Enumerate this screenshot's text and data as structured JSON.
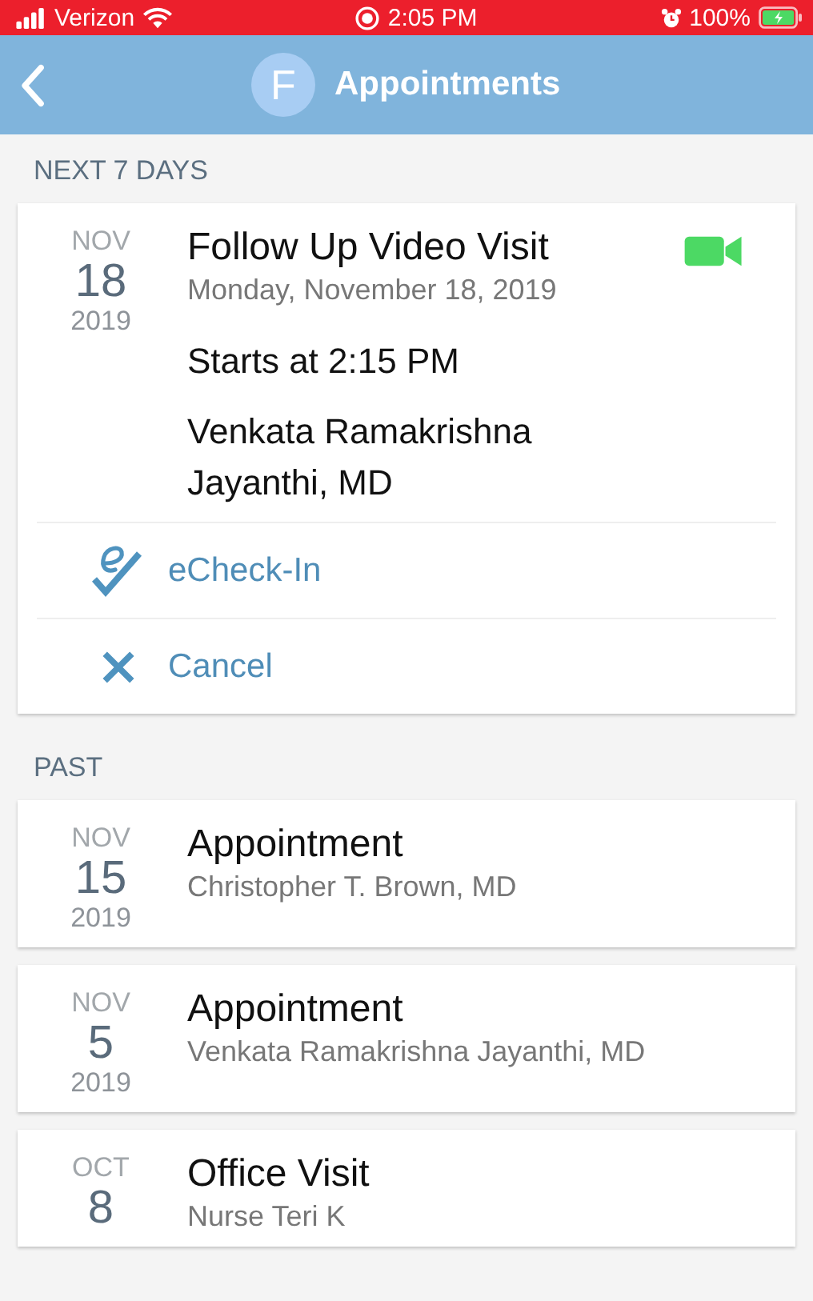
{
  "status_bar": {
    "carrier": "Verizon",
    "time": "2:05 PM",
    "battery": "100%"
  },
  "header": {
    "avatar_letter": "F",
    "title": "Appointments"
  },
  "sections": [
    {
      "heading": "NEXT 7 DAYS",
      "appointments": [
        {
          "month": "NOV",
          "day": "18",
          "year": "2019",
          "title": "Follow Up Video Visit",
          "subtitle": "Monday, November 18, 2019",
          "video": true,
          "details": [
            "Starts at 2:15 PM",
            "Venkata Ramakrishna Jayanthi, MD"
          ],
          "actions": [
            {
              "kind": "echeckin",
              "label": "eCheck-In"
            },
            {
              "kind": "cancel",
              "label": "Cancel"
            }
          ]
        }
      ]
    },
    {
      "heading": "PAST",
      "appointments": [
        {
          "month": "NOV",
          "day": "15",
          "year": "2019",
          "title": "Appointment",
          "subtitle": "Christopher T. Brown, MD"
        },
        {
          "month": "NOV",
          "day": "5",
          "year": "2019",
          "title": "Appointment",
          "subtitle": "Venkata Ramakrishna Jayanthi, MD"
        },
        {
          "month": "OCT",
          "day": "8",
          "title": "Office Visit",
          "subtitle": "Nurse Teri K"
        }
      ]
    }
  ]
}
